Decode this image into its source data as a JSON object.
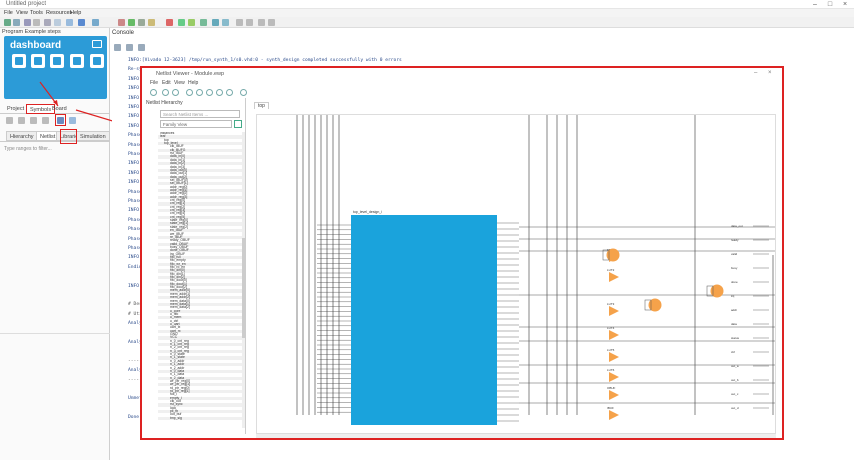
{
  "app": {
    "title": "Untitled project",
    "menu": [
      "File",
      "View",
      "Tools",
      "Resources",
      "Help"
    ]
  },
  "left_panel": {
    "header": "Program Example steps",
    "dashboard_logo": "dashboard",
    "tabs": [
      "Project",
      "Symbols",
      "Board"
    ],
    "sub_tabs": [
      "Hierarchy",
      "Netlist",
      "Libraries",
      "Simulation"
    ],
    "filter_placeholder": "Type ranges to filter..."
  },
  "console": {
    "tab_label": "Console",
    "lines": [
      {
        "prefix": "INFO:",
        "text": "[Vivado 12-3623] /tmp/run_synth_1/s0.vhd:0 - synth_design completed successfully with 0 errors"
      },
      {
        "prefix": "",
        "text": "Re-synth constraint: clock_ports(1) not found - design top_level_wrapper"
      },
      {
        "prefix": "INFO:",
        "text": "[Synth 8-638] synthesizing module 'top_level'"
      },
      {
        "prefix": "INFO:",
        "text": "[Synth 8-256] done synthesizing module 'top_level' (1#1)"
      },
      {
        "prefix": "INFO:",
        "text": "[Device 21-403] Loading part xc7a35ticsg324-1L"
      },
      {
        "prefix": "INFO:",
        "text": "[Project 1-570] Preparing netlist for logic optimization"
      },
      {
        "prefix": "INFO:",
        "text": "[Timing 38-35] Done setting XDC timing constraints"
      },
      {
        "prefix": "INFO:",
        "text": "[Opt 31-49] Retargeted 0 cell(s)"
      },
      {
        "prefix": "Ph",
        "text": "ase 1 Initialization"
      },
      {
        "prefix": "Ph",
        "text": "ase 2 Timer Update"
      },
      {
        "prefix": "Ph",
        "text": "ase 3 Retarget"
      },
      {
        "prefix": "INFO:",
        "text": "[Opt 31-389] Phase Retarget created 0 cells"
      },
      {
        "prefix": "INFO:",
        "text": "[Opt 31-138] Pushed 0 inverter(s)"
      },
      {
        "prefix": "INFO:",
        "text": "[Netlist 29-17] Analyzing 12 Unisim elements"
      },
      {
        "prefix": "Ph",
        "text": "ase 4 Constant propagation"
      },
      {
        "prefix": "Ph",
        "text": "ase 5 Sweep"
      },
      {
        "prefix": "INFO:",
        "text": "[Opt 31-389] Phase Sweep created 0 cells"
      },
      {
        "prefix": "Ph",
        "text": "ase 6 BUFG optimization"
      },
      {
        "prefix": "Ph",
        "text": "ase 7 Shift Register Optimization"
      },
      {
        "prefix": "Ph",
        "text": "ase 8 Post Processing Netlist"
      },
      {
        "prefix": "Ph",
        "text": "ase 9 Finalization"
      },
      {
        "prefix": "INFO:",
        "text": "[Common 17-83] Releasing license: Implementation"
      },
      {
        "prefix": "Ending",
        "text": " Logic Optimization Task"
      },
      {
        "prefix": "",
        "text": ""
      },
      {
        "prefix": "INFO:",
        "text": "[Power 33-23] Power model is not available"
      },
      {
        "prefix": "",
        "text": ""
      },
      {
        "prefix": "#",
        "text": " Design summary"
      },
      {
        "prefix": "#",
        "text": " Utilization report"
      },
      {
        "prefix": "Ana",
        "text": "lyzing design..."
      },
      {
        "prefix": "",
        "text": ""
      },
      {
        "prefix": "Ana",
        "text": "lyzing timing..."
      },
      {
        "prefix": "",
        "text": ""
      },
      {
        "prefix": "------",
        "text": "-----------------------------"
      },
      {
        "prefix": "Ana",
        "text": "lysis complete"
      },
      {
        "prefix": "------",
        "text": "-----------------------------"
      },
      {
        "prefix": "",
        "text": ""
      },
      {
        "prefix": "Unme",
        "text": "t constraints: 0"
      },
      {
        "prefix": "",
        "text": ""
      },
      {
        "prefix": "Done",
        "text": ""
      }
    ]
  },
  "viewer": {
    "title": "Netlist Viewer - Module.ewp",
    "menu": [
      "File",
      "Edit",
      "View",
      "Help"
    ],
    "panel_title": "Netlist Hierarchy",
    "search_placeholder": "Search Netlist Items ...",
    "filter_value": "Family View",
    "tab_label": "top",
    "nets": [
      "instances",
      "leaf",
      "top",
      "top_level",
      "clk_IBUF",
      "clk_BUFG",
      "rst_IBUF",
      "data_in[0]",
      "data_in[1]",
      "data_in[2]",
      "data_in[3]",
      "data_out[0]",
      "data_out[1]",
      "data_out[2]",
      "sel_IBUF[0]",
      "sel_IBUF[1]",
      "addr_reg[0]",
      "addr_reg[1]",
      "addr_reg[2]",
      "addr_reg[3]",
      "cnt_reg[0]",
      "cnt_reg[1]",
      "cnt_reg[2]",
      "cnt_reg[3]",
      "cnt_reg[4]",
      "cnt_reg[5]",
      "state_reg[0]",
      "state_reg[1]",
      "state_reg[2]",
      "en_IBUF",
      "we_IBUF",
      "re_IBUF",
      "ready_OBUF",
      "valid_OBUF",
      "busy_OBUF",
      "done_OBUF",
      "irq_OBUF",
      "fifo_full",
      "fifo_empty",
      "fifo_wr_en",
      "fifo_rd_en",
      "fifo_din[0]",
      "fifo_din[1]",
      "fifo_din[2]",
      "fifo_dout[0]",
      "fifo_dout[1]",
      "fifo_dout[2]",
      "mem_addr[0]",
      "mem_addr[1]",
      "mem_addr[2]",
      "mem_data[0]",
      "mem_data[1]",
      "mem_data[2]",
      "u_core",
      "u_fifo",
      "u_mem",
      "u_ctrl",
      "u_uart",
      "uart_tx",
      "uart_rx",
      "GND",
      "VCC",
      "n_0_cnt_reg",
      "n_1_cnt_reg",
      "n_2_cnt_reg",
      "n_3_cnt_reg",
      "n_0_state",
      "n_1_state",
      "n_0_addr",
      "n_1_addr",
      "n_2_addr",
      "n_0_data",
      "n_1_data",
      "n_2_data",
      "wr_ptr_reg[0]",
      "wr_ptr_reg[1]",
      "rd_ptr_reg[0]",
      "rd_ptr_reg[1]",
      "full_i",
      "empty_i",
      "clk_out",
      "rst_sync",
      "lock",
      "pll_fb",
      "out_buf",
      "tmp_sig"
    ],
    "block_label": "top_level_design_i",
    "port_labels": [
      "data_out",
      "ready",
      "valid",
      "busy",
      "done",
      "irq",
      "addr",
      "data",
      "status",
      "ctrl",
      "out_a",
      "out_b",
      "out_c",
      "out_d"
    ],
    "gate_labels": [
      "FDRE",
      "LUT2",
      "LUT3",
      "LUT4",
      "LUT5",
      "LUT6",
      "OBUF",
      "IBUF",
      "BUFG"
    ]
  },
  "colors": {
    "dashboard": "#2c9bd7",
    "highlight": "#d22222",
    "block": "#1aa3dc",
    "gate": "#f5a24a"
  }
}
